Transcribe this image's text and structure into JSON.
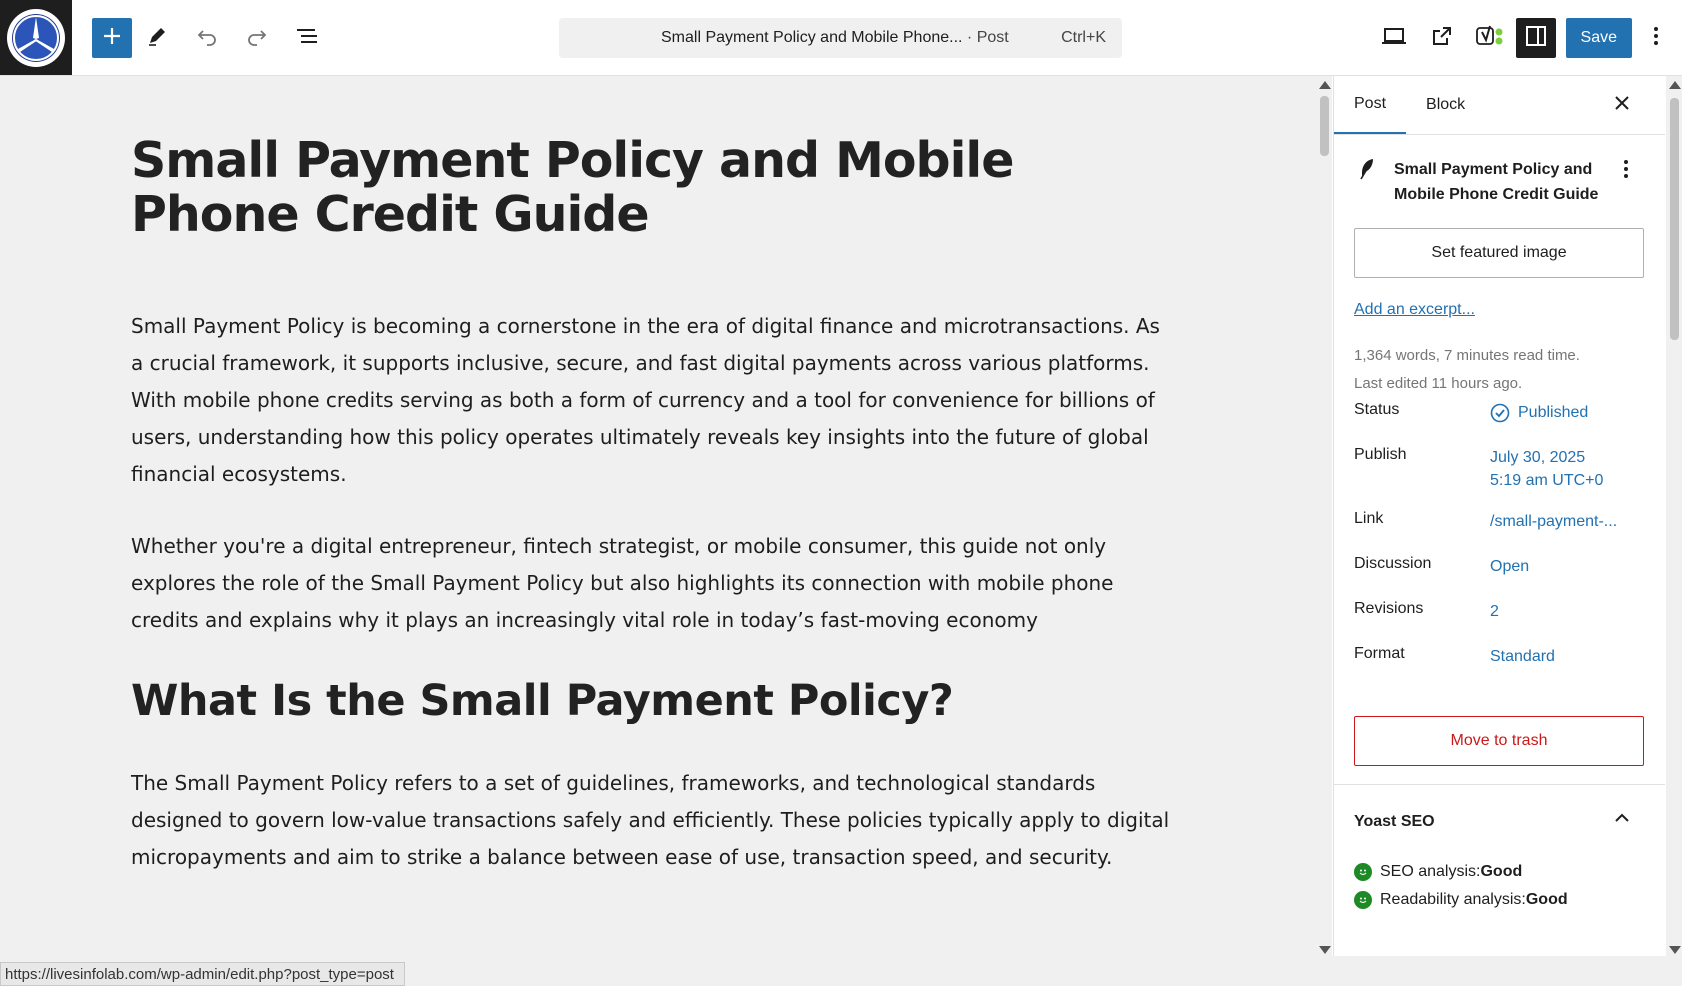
{
  "topbar": {
    "document_title": "Small Payment Policy and Mobile Phone...",
    "document_type": " · Post",
    "shortcut": "Ctrl+K",
    "save_label": "Save"
  },
  "post": {
    "title": "Small Payment Policy and Mobile Phone Credit Guide",
    "paragraphs": [
      "Small Payment Policy is becoming a cornerstone in the era of digital finance and microtransactions. As a crucial framework, it supports inclusive, secure, and fast digital payments across various platforms. With mobile phone credits serving as both a form of currency and a tool for convenience for billions of users, understanding how this policy operates ultimately reveals key insights into the future of global financial ecosystems.",
      "Whether you're a digital entrepreneur, fintech strategist, or mobile consumer, this guide not only explores the role of the Small Payment Policy but also highlights its connection with mobile phone credits and explains why it plays an increasingly vital role in today’s fast-moving economy",
      "The Small Payment Policy refers to a set of guidelines, frameworks, and technological standards designed to govern low-value transactions safely and efficiently. These policies typically apply to digital micropayments and aim to strike a balance between ease of use, transaction speed, and security."
    ],
    "heading2": "What Is the Small Payment Policy?"
  },
  "sidebar": {
    "tab_post": "Post",
    "tab_block": "Block",
    "doc_title": "Small Payment Policy and Mobile Phone Credit Guide",
    "featured_image": "Set featured image",
    "excerpt": "Add an excerpt...",
    "stats": "1,364 words, 7 minutes read time.",
    "last_edited": "Last edited 11 hours ago.",
    "status_label": "Status",
    "status_value": "Published",
    "publish_label": "Publish",
    "publish_date": "July 30, 2025",
    "publish_time": "5:19 am UTC+0",
    "link_label": "Link",
    "link_value": "/small-payment-...",
    "discussion_label": "Discussion",
    "discussion_value": "Open",
    "revisions_label": "Revisions",
    "revisions_value": "2",
    "format_label": "Format",
    "format_value": "Standard",
    "trash": "Move to trash",
    "yoast_title": "Yoast SEO",
    "seo_label": "SEO analysis: ",
    "seo_value": "Good",
    "read_label": "Readability analysis: ",
    "read_value": "Good"
  },
  "statusbar": {
    "url": "https://livesinfolab.com/wp-admin/edit.php?post_type=post"
  },
  "colors": {
    "accent": "#2271b1",
    "danger": "#cc1818",
    "good": "#1e8a25"
  }
}
